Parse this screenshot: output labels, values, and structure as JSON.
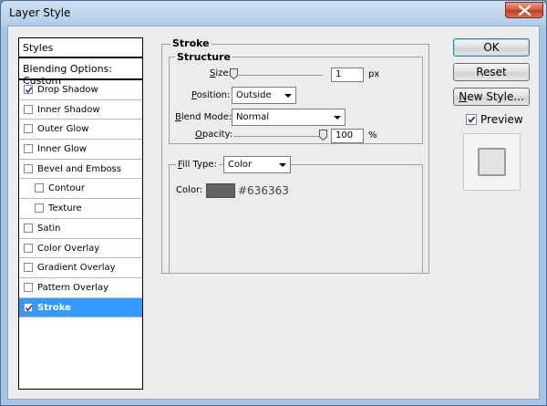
{
  "window": {
    "title": "Layer Style"
  },
  "styles_panel": {
    "header": "Styles",
    "blending_options": "Blending Options: Custom",
    "items": [
      {
        "label": "Drop Shadow",
        "checked": true,
        "sub": false,
        "selected": false
      },
      {
        "label": "Inner Shadow",
        "checked": false,
        "sub": false,
        "selected": false
      },
      {
        "label": "Outer Glow",
        "checked": false,
        "sub": false,
        "selected": false
      },
      {
        "label": "Inner Glow",
        "checked": false,
        "sub": false,
        "selected": false
      },
      {
        "label": "Bevel and Emboss",
        "checked": false,
        "sub": false,
        "selected": false
      },
      {
        "label": "Contour",
        "checked": false,
        "sub": true,
        "selected": false
      },
      {
        "label": "Texture",
        "checked": false,
        "sub": true,
        "selected": false
      },
      {
        "label": "Satin",
        "checked": false,
        "sub": false,
        "selected": false
      },
      {
        "label": "Color Overlay",
        "checked": false,
        "sub": false,
        "selected": false
      },
      {
        "label": "Gradient Overlay",
        "checked": false,
        "sub": false,
        "selected": false
      },
      {
        "label": "Pattern Overlay",
        "checked": false,
        "sub": false,
        "selected": false
      },
      {
        "label": "Stroke",
        "checked": true,
        "sub": false,
        "selected": true
      }
    ]
  },
  "stroke": {
    "group_title": "Stroke",
    "structure_title": "Structure",
    "size": {
      "label_access": "S",
      "label_rest": "ize:",
      "value": "1",
      "unit": "px",
      "slider_fraction": 0.01
    },
    "position": {
      "label_access": "P",
      "label_rest": "osition:",
      "value": "Outside"
    },
    "blend_mode": {
      "label_access": "B",
      "label_rest": "lend Mode:",
      "value": "Normal"
    },
    "opacity": {
      "label_access": "O",
      "label_rest": "pacity:",
      "value": "100",
      "unit": "%",
      "slider_fraction": 1.0
    },
    "fill_type": {
      "label_access": "F",
      "label_rest": "ill Type:",
      "value": "Color"
    },
    "color": {
      "label": "Color:",
      "hex": "#636363"
    }
  },
  "buttons": {
    "ok": "OK",
    "reset": "Reset",
    "new_style_access": "N",
    "new_style_rest": "ew Style...",
    "preview_label": "Preview",
    "preview_checked": true
  },
  "colors": {
    "selection": "#3399ff",
    "swatch": "#636363",
    "titlebar": "#b9d0ea"
  }
}
